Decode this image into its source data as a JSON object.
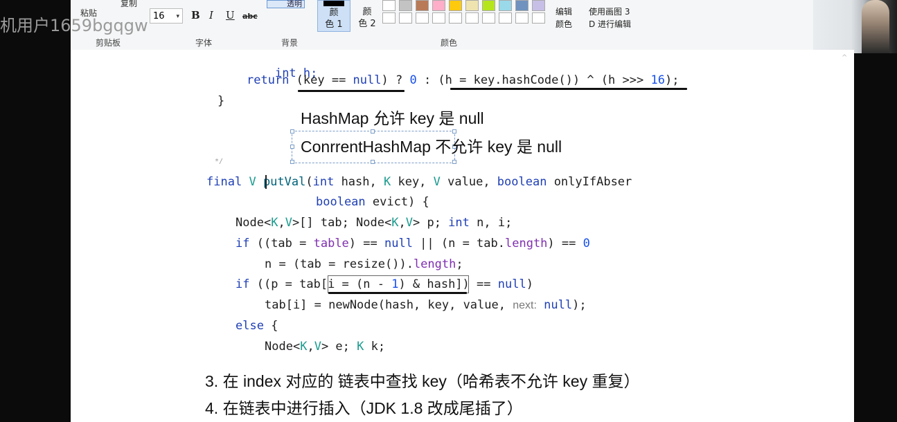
{
  "watermark": "机用户1659bgqgw",
  "ribbon": {
    "clipboard": {
      "paste": "粘贴",
      "copy": "复制",
      "group": "剪贴板"
    },
    "font": {
      "size": "16",
      "bold": "B",
      "italic": "I",
      "underline": "U",
      "strike": "abc",
      "group": "字体"
    },
    "background": {
      "transparent": "透明",
      "group": "背景"
    },
    "colors": {
      "color1": "颜色 1",
      "color1_l1": "颜",
      "color1_l2": "色 1",
      "color2_l1": "颜",
      "color2_l2": "色 2",
      "group": "颜色",
      "palette": [
        "#ffffff",
        "#c3c3c3",
        "#b97a57",
        "#ffaec9",
        "#ffc90e",
        "#efe4b0",
        "#b5e61d",
        "#99d9ea",
        "#7092be",
        "#c8bfe7"
      ],
      "edit_l1": "编辑",
      "edit_l2": "颜色"
    },
    "paint3d_l1": "使用画图 3",
    "paint3d_l2": "D 进行编辑"
  },
  "code_top": {
    "line1": "int h;",
    "return_kw": "return",
    "return_part1": " (key == ",
    "null": "null",
    "return_part2": ") ? ",
    "zero": "0",
    "return_part3": " : (h = key.hashCode()) ^ (h >>> ",
    "sixteen": "16",
    "return_part4": ");",
    "brace": "}",
    "comment_end": "*/"
  },
  "notes": {
    "note1": "HashMap 允许 key 是 null",
    "note2": "ConrrentHashMap 不允许 key 是 null"
  },
  "code_main": {
    "final_kw": "final",
    "V": "V",
    "method": "putVal",
    "params_open": "(",
    "int_kw": "int",
    "p_hash": " hash, ",
    "K": "K",
    "p_key": " key, ",
    "p_value": " value, ",
    "boolean_kw": "boolean",
    "p_only": " onlyIfAbser",
    "p_evict": " evict) {",
    "l3_a": "Node<",
    "l3_b": ",",
    "l3_c": ">[] tab; Node<",
    "l3_d": "> p; ",
    "l3_e": " n, i;",
    "if_kw": "if",
    "l4_a": " ((tab = ",
    "table": "table",
    "l4_b": ") == ",
    "l4_c": " || (n = tab.",
    "length": "length",
    "l4_d": ") == ",
    "l5_a": "n = (tab = resize()).",
    "l5_b": ";",
    "l6_a": " ((p = tab[i = (n - ",
    "one": "1",
    "l6_b": ") & hash]) == ",
    "l6_c": ")",
    "l7_a": "tab[i] = newNode(hash, key, value, ",
    "next_hint": "next:",
    "l7_b": ");",
    "else_kw": "else",
    "l8_b": " {",
    "l9_a": "Node<",
    "l9_b": "> e; ",
    "l9_c": " k;"
  },
  "steps": {
    "step3": "3. 在 index 对应的 链表中查找 key（哈希表不允许 key 重复）",
    "step4": "4. 在链表中进行插入（JDK 1.8 改成尾插了）"
  }
}
